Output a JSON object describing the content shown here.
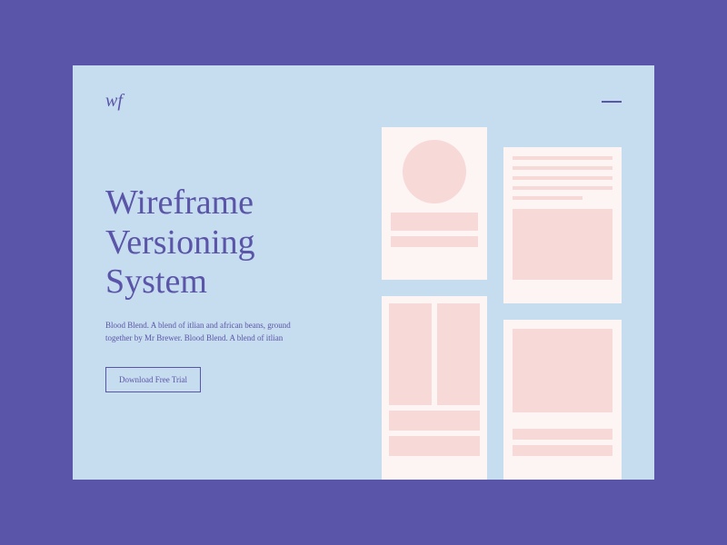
{
  "header": {
    "logo": "wf"
  },
  "hero": {
    "title": "Wireframe Versioning System",
    "description": "Blood Blend. A blend of itlian and african beans, ground together by Mr Brewer. Blood Blend. A blend of itlian",
    "cta": "Download Free Trial"
  },
  "colors": {
    "background": "#5a55a8",
    "card": "#c6dcef",
    "panel": "#fdf4f4",
    "shape": "#f7d9d7"
  }
}
